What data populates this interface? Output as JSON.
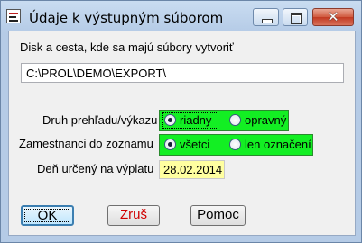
{
  "window": {
    "title": "Údaje k výstupným súborom",
    "close_symbol": "✕"
  },
  "export": {
    "path_label": "Disk a cesta, kde sa majú súbory vytvoriť",
    "path_value": "C:\\PROL\\DEMO\\EXPORT\\"
  },
  "report_type": {
    "label": "Druh prehľadu/výkazu",
    "options": [
      "riadny",
      "opravný"
    ],
    "selected": "riadny"
  },
  "employees": {
    "label": "Zamestnanci do zoznamu",
    "options": [
      "všetci",
      "len označení"
    ],
    "selected": "všetci"
  },
  "payment_day": {
    "label": "Deň určený na výplatu",
    "value": "28.02.2014"
  },
  "buttons": {
    "ok": "OK",
    "cancel": "Zruš",
    "help": "Pomoc"
  },
  "colors": {
    "group_highlight": "#13ef23",
    "date_field_bg": "#ffffa0",
    "cancel_text": "#d00000"
  }
}
